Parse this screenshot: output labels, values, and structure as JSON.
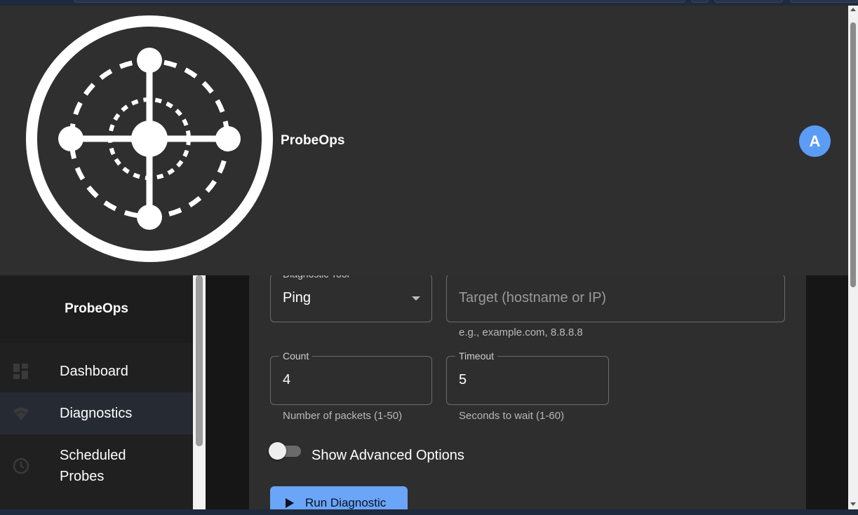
{
  "app": {
    "brand_name": "ProbeOps",
    "avatar_initial": "A"
  },
  "sidebar": {
    "brand_name": "ProbeOps",
    "items": [
      {
        "label": "Dashboard",
        "icon": "dashboard-icon",
        "active": false
      },
      {
        "label": "Diagnostics",
        "icon": "wifi-icon",
        "active": true
      },
      {
        "label": "Scheduled Probes",
        "icon": "clock-icon",
        "active": false
      }
    ]
  },
  "form": {
    "tool": {
      "legend": "Diagnostic Tool",
      "value": "Ping"
    },
    "target": {
      "placeholder": "Target (hostname or IP)",
      "helper": "e.g., example.com, 8.8.8.8"
    },
    "count": {
      "legend": "Count",
      "value": "4",
      "helper": "Number of packets (1-50)"
    },
    "timeout": {
      "legend": "Timeout",
      "value": "5",
      "helper": "Seconds to wait (1-60)"
    },
    "advanced_toggle": {
      "label": "Show Advanced Options",
      "checked": false
    },
    "run_button": {
      "label": "Run Diagnostic"
    }
  },
  "colors": {
    "accent": "#5b9cf6",
    "button": "#6aa5f7",
    "appbar": "#2f2f2f",
    "card": "#2e2e2e"
  }
}
